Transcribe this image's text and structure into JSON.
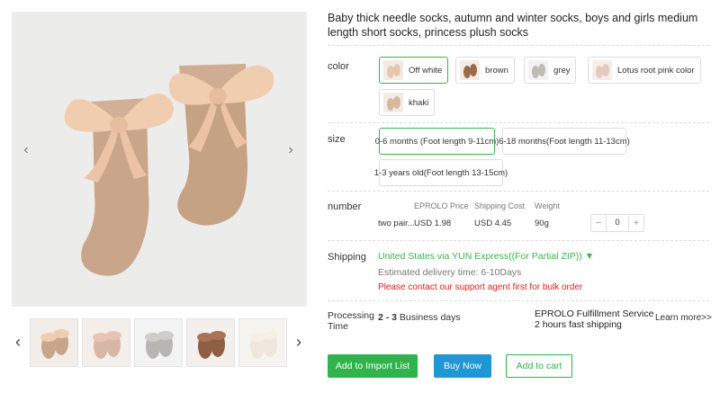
{
  "product": {
    "title": "Baby thick needle socks, autumn and winter socks, boys and girls medium length short socks, princess plush socks"
  },
  "gallery": {
    "prev_icon": "chevron-left-icon",
    "next_icon": "chevron-right-icon",
    "thumb_count": 5
  },
  "color": {
    "label": "color",
    "options": [
      {
        "label": "Off white",
        "selected": true,
        "swatch": "#e8c8ac"
      },
      {
        "label": "brown",
        "selected": false,
        "swatch": "#9a6a4c"
      },
      {
        "label": "grey",
        "selected": false,
        "swatch": "#bdbbb6"
      },
      {
        "label": "Lotus root pink color",
        "selected": false,
        "swatch": "#e6c8c0"
      },
      {
        "label": "khaki",
        "selected": false,
        "swatch": "#d8b79a"
      }
    ]
  },
  "size": {
    "label": "size",
    "options": [
      {
        "label": "0-6 months (Foot length 9-11cm)",
        "selected": true
      },
      {
        "label": "6-18 months(Foot length 11-13cm)",
        "selected": false
      },
      {
        "label": "1-3 years old(Foot length 13-15cm)",
        "selected": false
      }
    ]
  },
  "number": {
    "label": "number",
    "headers": {
      "price": "EPROLO Price",
      "shipping": "Shipping Cost",
      "weight": "Weight"
    },
    "row": {
      "name": "two pair...",
      "price": "USD 1.98",
      "shipping": "USD 4.45",
      "weight": "90g"
    },
    "quantity": "0",
    "minus": "−",
    "plus": "+"
  },
  "shipping": {
    "label": "Shipping",
    "method": "United States via YUN Express((For Partial ZIP)) ▼",
    "estimate": "Estimated delivery time: 6-10Days",
    "warning": "Please contact our support agent first for bulk order"
  },
  "processing": {
    "label": "Processing Time",
    "days_bold": "2 - 3",
    "days_text": " Business days",
    "fulfillment_line1": "EPROLO Fulfillment Service",
    "fulfillment_line2": "2 hours fast shipping",
    "learn_more": "Learn more>>"
  },
  "actions": {
    "import": "Add to Import List",
    "buy": "Buy Now",
    "cart": "Add to cart"
  },
  "colors": {
    "green": "#2fb34a",
    "blue": "#2096d4",
    "red": "#e02020"
  }
}
